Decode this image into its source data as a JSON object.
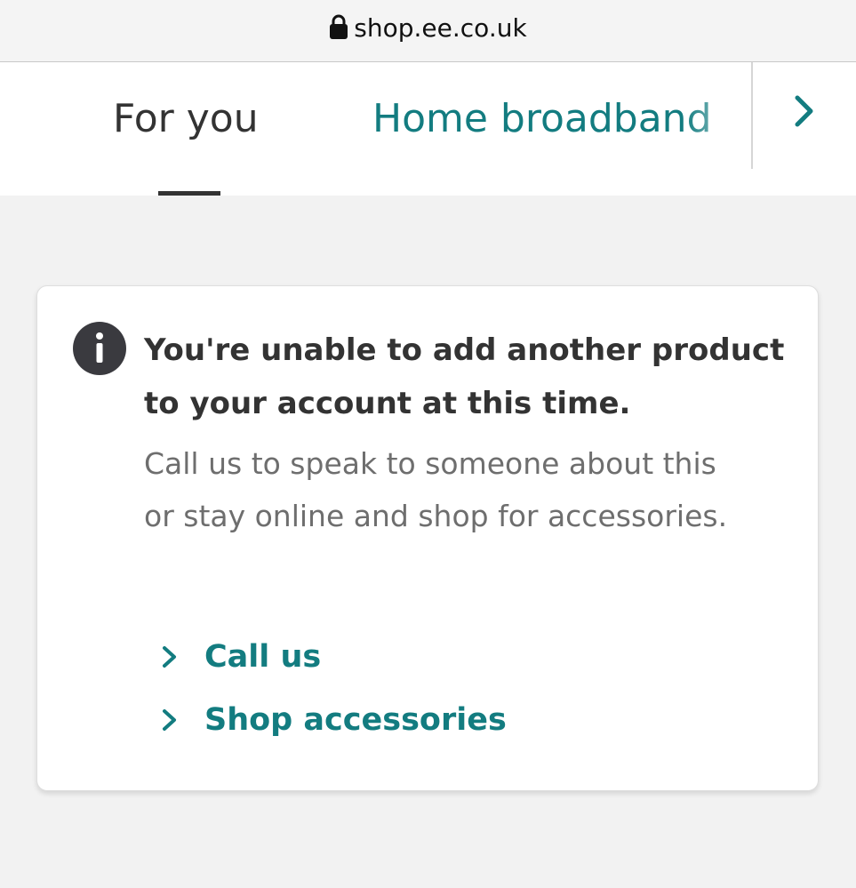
{
  "browser": {
    "url": "shop.ee.co.uk",
    "lock_icon": "lock-icon"
  },
  "tabs": {
    "items": [
      {
        "label": "For you",
        "active": true
      },
      {
        "label": "Home broadband",
        "active": false
      }
    ],
    "next_icon": "chevron-right-icon"
  },
  "notice": {
    "icon": "info-icon",
    "title": "You're unable to add another product to your account at this time.",
    "body": "Call us to speak to someone about this or stay online and shop for accessories.",
    "links": [
      {
        "label": "Call us",
        "icon": "chevron-right-icon"
      },
      {
        "label": "Shop accessories",
        "icon": "chevron-right-icon"
      }
    ]
  },
  "colors": {
    "brand_teal": "#137c80",
    "text_dark": "#333333",
    "text_muted": "#6e6e6e",
    "page_background": "#f2f2f2"
  }
}
